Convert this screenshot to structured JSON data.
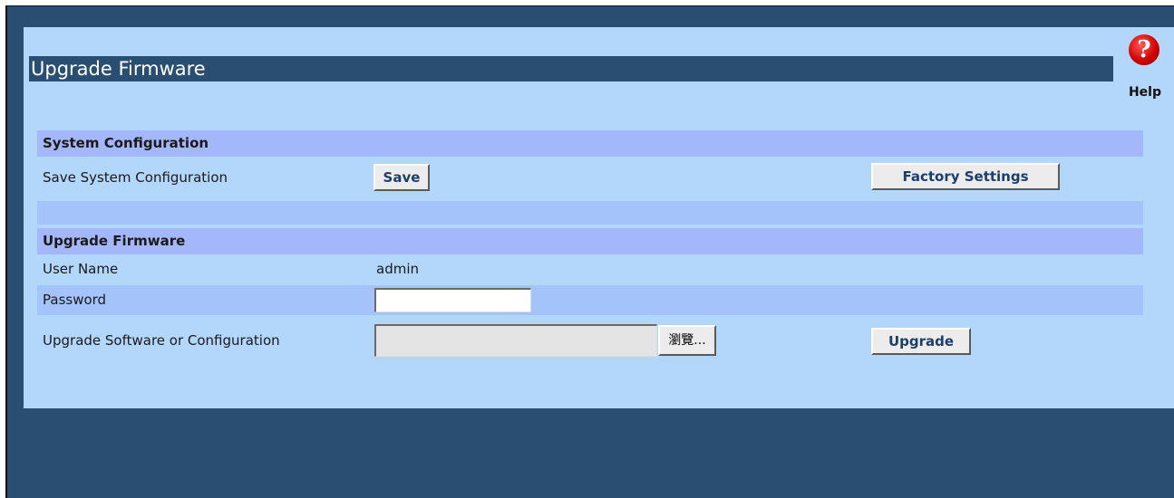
{
  "page": {
    "title": "Upgrade Firmware",
    "help": {
      "icon": "help-icon",
      "glyph": "?",
      "label": "Help"
    }
  },
  "system_config": {
    "heading": "System Configuration",
    "save_row_label": "Save System Configuration",
    "save_button": "Save",
    "factory_button": "Factory Settings"
  },
  "upgrade": {
    "heading": "Upgrade Firmware",
    "username_label": "User Name",
    "username_value": "admin",
    "password_label": "Password",
    "password_value": "",
    "file_label": "Upgrade Software or Configuration",
    "file_value": "",
    "browse_button": "瀏覽...",
    "upgrade_button": "Upgrade"
  },
  "colors": {
    "frame": "#2a4e72",
    "panel": "#b3d6fb",
    "section_header": "#a5b7fb",
    "button_text": "#1d3e68"
  }
}
